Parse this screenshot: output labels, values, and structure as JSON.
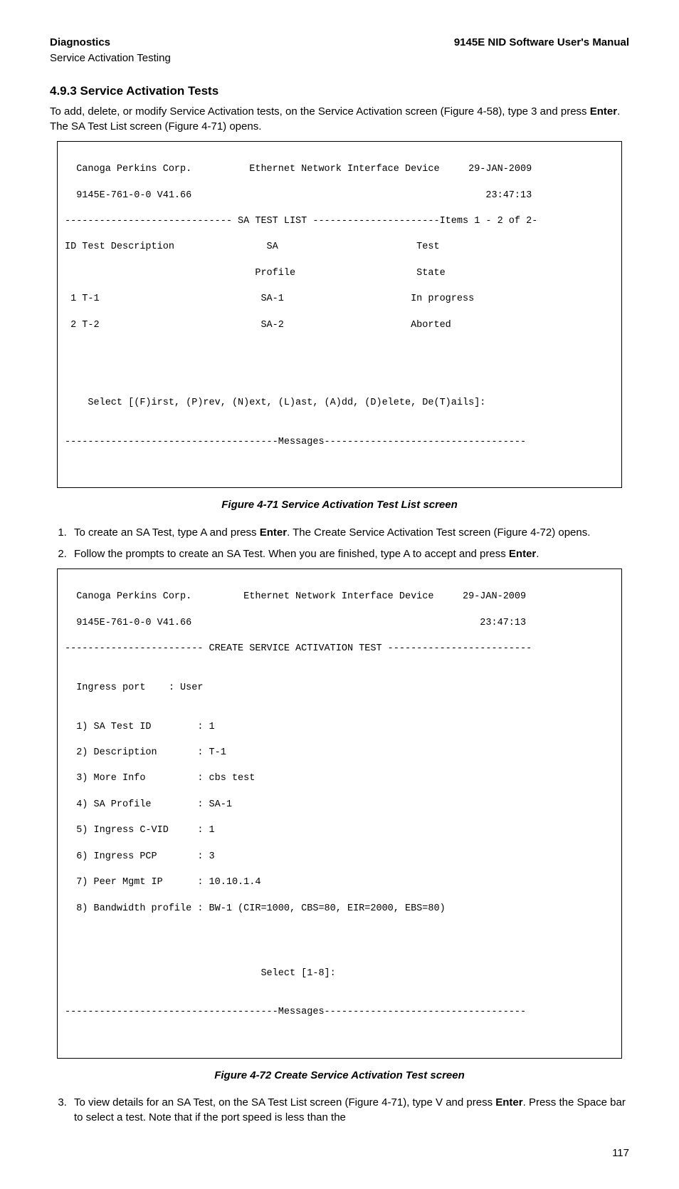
{
  "header": {
    "left": "Diagnostics",
    "right": "9145E NID Software User's Manual",
    "sub": "Service Activation Testing"
  },
  "section": {
    "num_title": "4.9.3  Service Activation Tests",
    "intro_a": "To add, delete, or modify Service Activation tests, on the Service Activation screen (Figure 4-58), type 3 and press ",
    "intro_b": "Enter",
    "intro_c": ". The SA Test List screen (Figure 4-71) opens."
  },
  "term1": {
    "l1": "  Canoga Perkins Corp.          Ethernet Network Interface Device     29-JAN-2009",
    "l2": "  9145E-761-0-0 V41.66                                                   23:47:13",
    "l3": "----------------------------- SA TEST LIST ----------------------Items 1 - 2 of 2-",
    "l4": "ID Test Description                SA                        Test",
    "l5": "                                 Profile                     State",
    "l6": " 1 T-1                            SA-1                      In progress",
    "l7": " 2 T-2                            SA-2                      Aborted",
    "l8": "",
    "l9": "",
    "l10": "",
    "l11": "",
    "l12": "    Select [(F)irst, (P)rev, (N)ext, (L)ast, (A)dd, (D)elete, De(T)ails]:",
    "l13": "",
    "l14": "-------------------------------------Messages-----------------------------------",
    "l15": ""
  },
  "fig1": "Figure 4-71  Service Activation Test List screen",
  "step1": {
    "a": "To create an SA Test, type A and press ",
    "b": "Enter",
    "c": ". The Create Service Activation Test screen (Figure 4-72) opens."
  },
  "step2": {
    "a": "Follow the prompts to create an SA Test.  When you are finished, type A to accept and press ",
    "b": "Enter",
    "c": "."
  },
  "term2": {
    "l1": "  Canoga Perkins Corp.         Ethernet Network Interface Device     29-JAN-2009",
    "l2": "  9145E-761-0-0 V41.66                                                  23:47:13",
    "l3": "------------------------ CREATE SERVICE ACTIVATION TEST -------------------------",
    "l4": "",
    "l5": "  Ingress port    : User",
    "l6": "",
    "l7": "  1) SA Test ID        : 1",
    "l8": "  2) Description       : T-1",
    "l9": "  3) More Info         : cbs test",
    "l10": "  4) SA Profile        : SA-1",
    "l11": "  5) Ingress C-VID     : 1",
    "l12": "  6) Ingress PCP       : 3",
    "l13": "  7) Peer Mgmt IP      : 10.10.1.4",
    "l14": "  8) Bandwidth profile : BW-1 (CIR=1000, CBS=80, EIR=2000, EBS=80)",
    "l15": "",
    "l16": "",
    "l17": "",
    "l18": "                                  Select [1-8]:",
    "l19": "",
    "l20": "-------------------------------------Messages-----------------------------------",
    "l21": ""
  },
  "fig2": "Figure 4-72  Create Service Activation Test screen",
  "step3": {
    "a": "To view details for an SA Test, on the SA Test List screen (Figure 4-71), type V and press ",
    "b": "Enter",
    "c": ".   Press the Space bar to select a test. Note that if the port speed is less than the"
  },
  "page": "117"
}
